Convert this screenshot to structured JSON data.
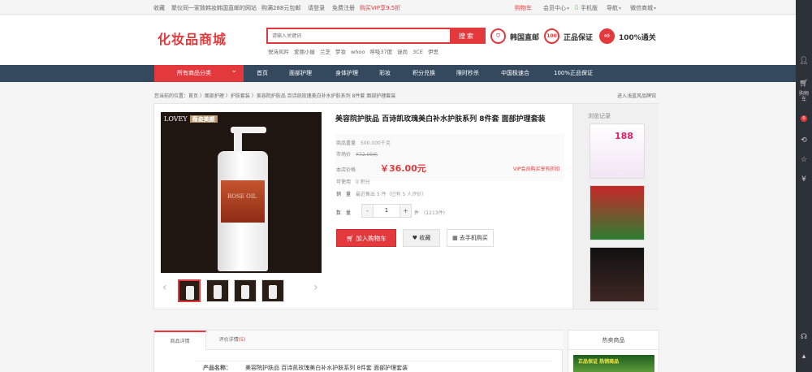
{
  "topbar": {
    "favorite": "收藏",
    "slogan": "聚仪同一家致韩妆韩国直邮的网站",
    "free_shipping": "购满288元包邮",
    "login": "请登录",
    "register": "免费注册",
    "vip_promo": "购买VIP享9.5折",
    "cart": "购物车",
    "member_center": "会员中心",
    "mobile": "手机版",
    "navigation": "导航",
    "wechat": "微信商城"
  },
  "header": {
    "logo": "化妆品商城",
    "search_placeholder": "请输入关键词",
    "search_button": "搜索",
    "hotwords": [
      "悦诗风吟",
      "爱丽小屋",
      "兰芝",
      "梦妆",
      "whoo",
      "呼吸37度",
      "谜尚",
      "3CE",
      "伊思"
    ],
    "badges": [
      {
        "icon": "shield-icon",
        "text": "韩国直邮"
      },
      {
        "icon": "100",
        "text": "正品保证"
      },
      {
        "icon": "thumb-up-icon",
        "text": "100%通关"
      }
    ]
  },
  "nav": {
    "category": "所有商品分类",
    "items": [
      "首页",
      "面部护理",
      "身体护理",
      "彩妆",
      "积分兑换",
      "限时秒杀",
      "中国极速合",
      "100%正品保证"
    ]
  },
  "breadcrumb": "您当前的位置：首页 〉面部护理 〉护肤套装 〉美容院护肤品 百诗凯玫瑰美白补水护肤系列 8件套 面部护理套装",
  "store_link": "进入浅蓝风品牌馆",
  "product": {
    "brand_image_text": "LOVEY",
    "brand_image_cn": "薇姿美颜",
    "bottle_label": "ROSE OIL",
    "title": "美容院护肤品 百诗凯玫瑰美白补水护肤系列 8件套 面部护理套装",
    "weight_label": "商品重量",
    "weight_value": "500.000千克",
    "market_label": "市场价",
    "market_price": "¥72.00元",
    "store_label": "本店价格",
    "price": "￥36.00元",
    "vip_note": "VIP会员购买享有折扣",
    "points_label": "可使用",
    "points_value": "0 积分",
    "sales_label": "销　量",
    "sales_value": "最近售出 5 件（已有 5 人评价）",
    "qty_label": "数　量",
    "qty_minus": "-",
    "qty_value": "1",
    "qty_plus": "+",
    "qty_unit": "件",
    "stock": "(1213件)",
    "add_cart": "加入购物车",
    "favorite": "收藏",
    "mobile_buy": "去手机购买",
    "thumb_prev": "‹",
    "thumb_next": "›"
  },
  "browse": {
    "title": "浏览记录",
    "badge_text": "188"
  },
  "detail": {
    "tabs": [
      "商品详情",
      "评价详情"
    ],
    "review_count": "(5)",
    "spec_label": "产品名称：",
    "spec_value": "美容院护肤品 百诗凯玫瑰美白补水护肤系列 8件套 面部护理套装"
  },
  "hot": {
    "title": "热卖商品",
    "banner": "正品保证 热销商品"
  },
  "sidebar": {
    "cart_text": "购物车",
    "cart_count": "0"
  }
}
